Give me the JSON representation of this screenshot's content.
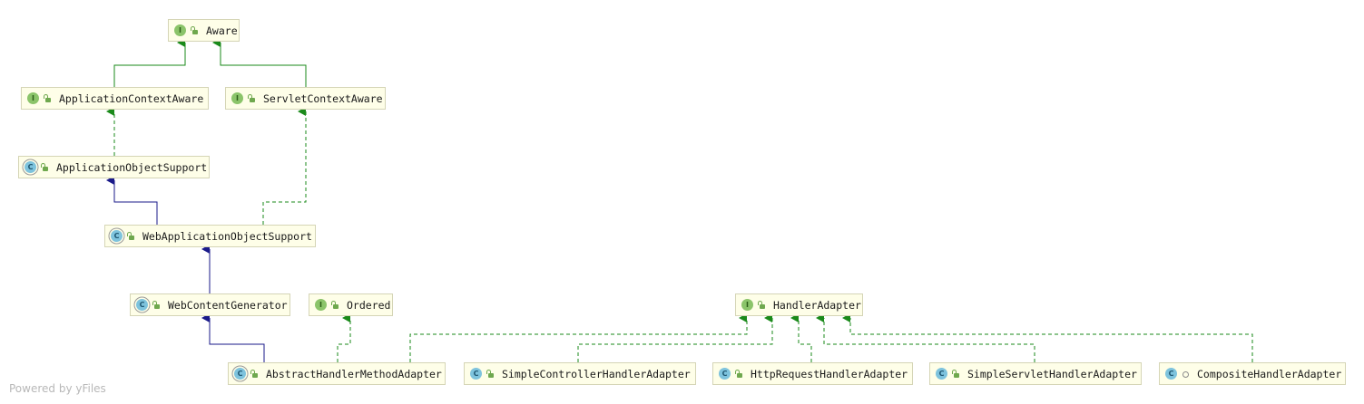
{
  "nodes": [
    {
      "id": "aware",
      "label": "Aware",
      "kind": "interface",
      "access": "public"
    },
    {
      "id": "application-context-aware",
      "label": "ApplicationContextAware",
      "kind": "interface",
      "access": "public"
    },
    {
      "id": "servlet-context-aware",
      "label": "ServletContextAware",
      "kind": "interface",
      "access": "public"
    },
    {
      "id": "application-object-support",
      "label": "ApplicationObjectSupport",
      "kind": "abstract-class",
      "access": "public"
    },
    {
      "id": "web-application-object-support",
      "label": "WebApplicationObjectSupport",
      "kind": "abstract-class",
      "access": "public"
    },
    {
      "id": "web-content-generator",
      "label": "WebContentGenerator",
      "kind": "abstract-class",
      "access": "public"
    },
    {
      "id": "ordered",
      "label": "Ordered",
      "kind": "interface",
      "access": "public"
    },
    {
      "id": "handler-adapter",
      "label": "HandlerAdapter",
      "kind": "interface",
      "access": "public"
    },
    {
      "id": "abstract-handler-method-adapter",
      "label": "AbstractHandlerMethodAdapter",
      "kind": "abstract-class",
      "access": "public"
    },
    {
      "id": "simple-controller-handler-adapter",
      "label": "SimpleControllerHandlerAdapter",
      "kind": "class",
      "access": "public"
    },
    {
      "id": "http-request-handler-adapter",
      "label": "HttpRequestHandlerAdapter",
      "kind": "class",
      "access": "public"
    },
    {
      "id": "simple-servlet-handler-adapter",
      "label": "SimpleServletHandlerAdapter",
      "kind": "class",
      "access": "public"
    },
    {
      "id": "composite-handler-adapter",
      "label": "CompositeHandlerAdapter",
      "kind": "class",
      "access": "package"
    }
  ],
  "kind_letters": {
    "interface": "I",
    "class": "C",
    "abstract-class": "C"
  },
  "colors": {
    "interface_inheritance": "#1a8a1a",
    "class_inheritance": "#1a1a8a",
    "node_fill": "#fefee8",
    "node_border": "#d5d5b6"
  },
  "edge_types": {
    "extends_interface": "solid green",
    "implements": "dashed green",
    "extends_class": "solid navy"
  },
  "watermark": "Powered by yFiles"
}
